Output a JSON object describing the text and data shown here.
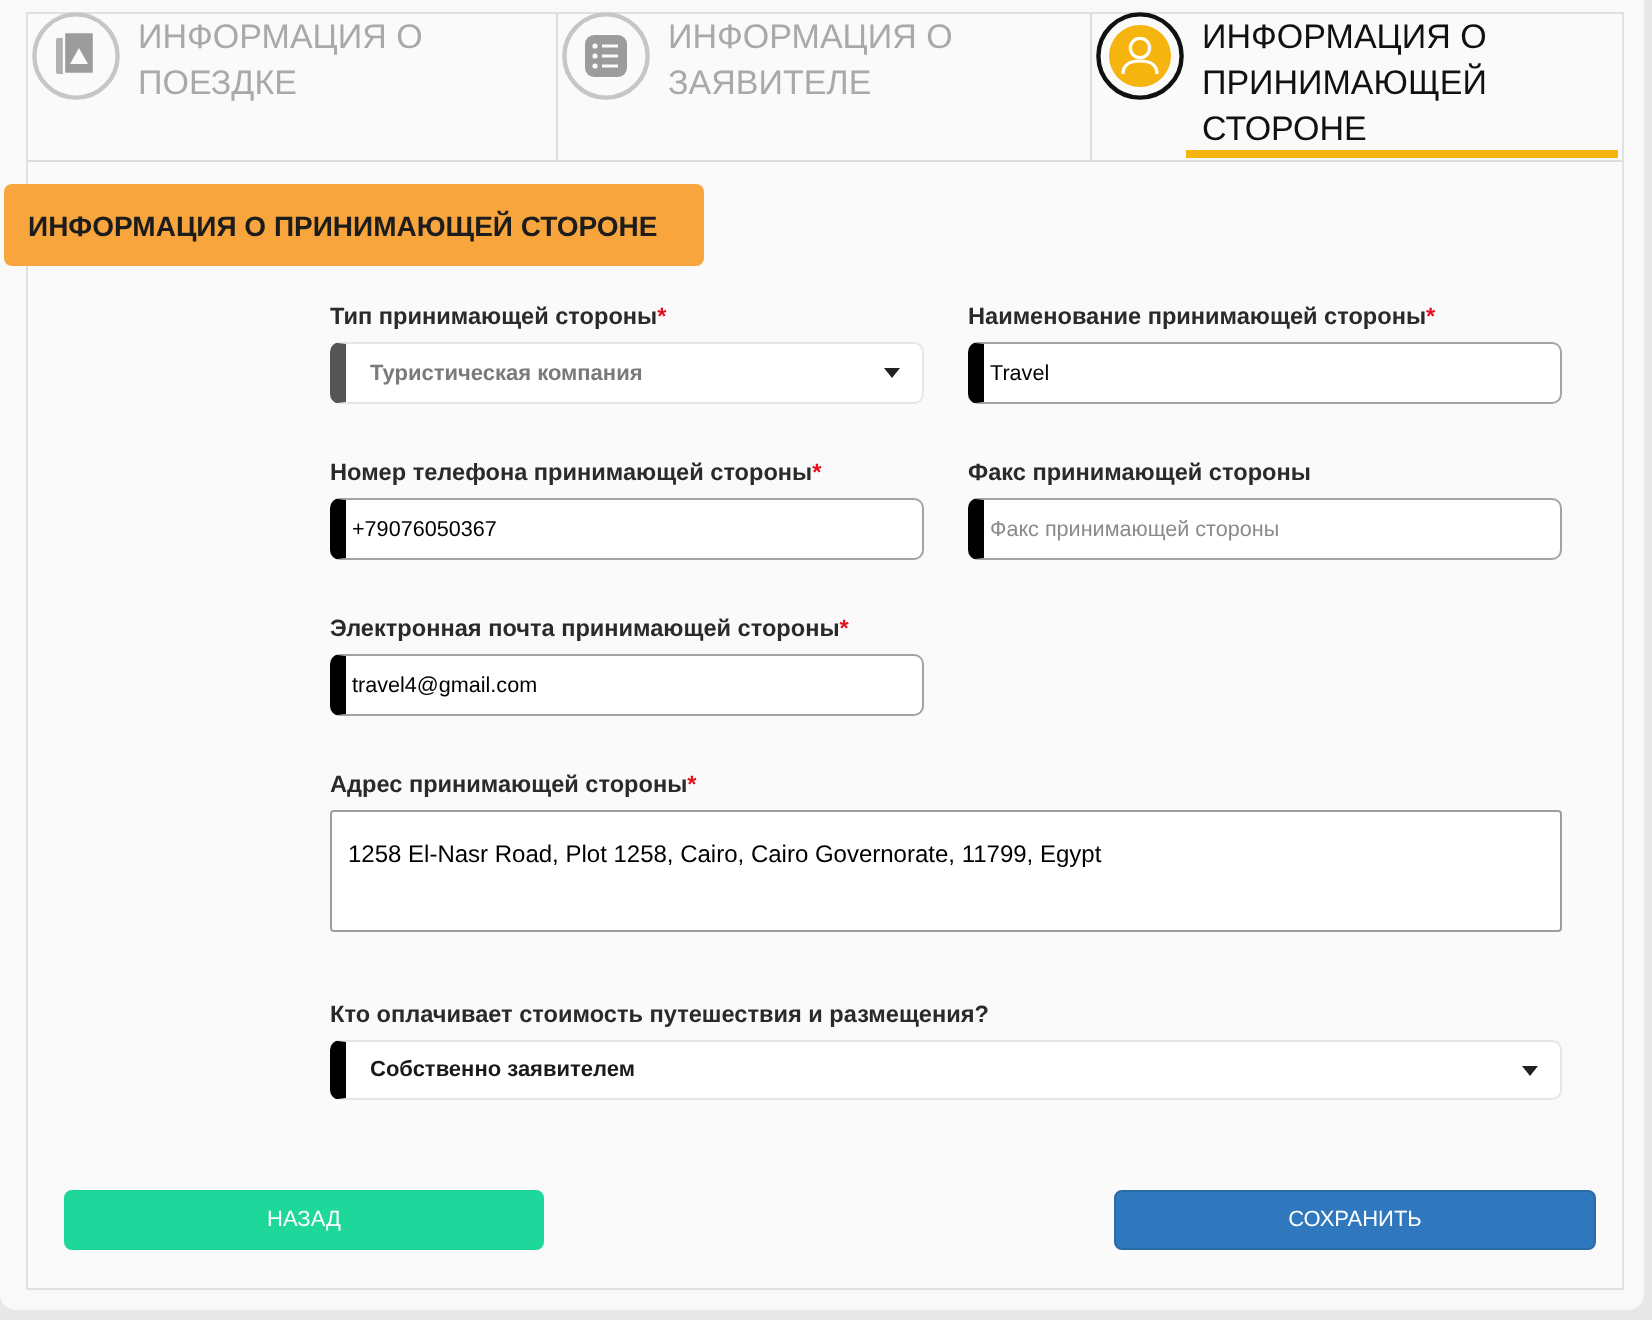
{
  "steps": [
    {
      "label": "ИНФОРМАЦИЯ О ПОЕЗДКЕ",
      "selected": false
    },
    {
      "label": "ИНФОРМАЦИЯ О ЗАЯВИТЕЛЕ",
      "selected": false
    },
    {
      "label": "ИНФОРМАЦИЯ О ПРИНИМАЮЩЕЙ СТОРОНЕ",
      "selected": true
    }
  ],
  "section_title": "ИНФОРМАЦИЯ О ПРИНИМАЮЩЕЙ СТОРОНЕ",
  "fields": [
    {
      "kind": "select",
      "label": "Тип принимающей стороны",
      "asterisk": "*",
      "value": "Туристическая компания",
      "disabled": true,
      "wide": false
    },
    {
      "kind": "text",
      "label": "Наименование принимающей стороны",
      "asterisk": "*",
      "value": "Travel",
      "disabled": false,
      "wide": false
    },
    {
      "kind": "text",
      "label": "Номер телефона принимающей стороны",
      "asterisk": "*",
      "value": "+79076050367",
      "disabled": false,
      "wide": false
    },
    {
      "kind": "text",
      "label": "Факс принимающей стороны",
      "placeholder": "Факс принимающей стороны",
      "disabled": false,
      "wide": false
    },
    {
      "kind": "text",
      "label": "Электронная почта принимающей стороны",
      "asterisk": "*",
      "value": "travel4@gmail.com",
      "disabled": false,
      "wide": false
    },
    {
      "kind": "textarea",
      "label": "Адрес принимающей стороны",
      "asterisk": "*",
      "value": "1258 El-Nasr Road, Plot 1258, Cairo, Cairo Governorate, 11799, Egypt",
      "disabled": false,
      "wide": true
    },
    {
      "kind": "select",
      "label": "Кто оплачивает стоимость путешествия и размещения?",
      "value": "Собственно заявителем",
      "disabled": false,
      "wide": true
    }
  ],
  "buttons": [
    {
      "label": "НАЗАД",
      "kind": "back"
    },
    {
      "label": "СОХРАНИТЬ",
      "kind": "save"
    }
  ]
}
